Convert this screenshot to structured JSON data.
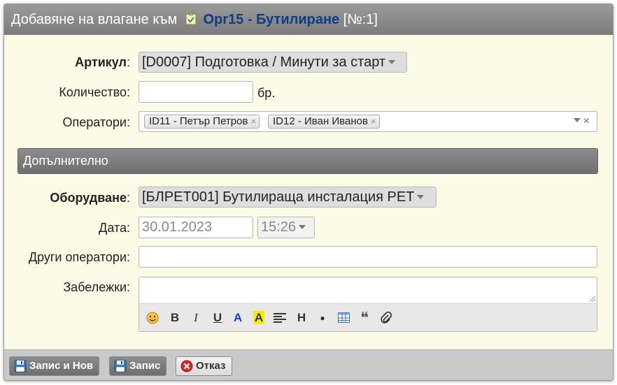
{
  "dialog": {
    "title_prefix": "Добавяне на влагане към",
    "title_link": "Opr15 - Бутилиране",
    "title_suffix": "[№:1]"
  },
  "form": {
    "article_label": "Артикул",
    "article_value": "[D0007] Подготовка / Минути за старт",
    "quantity_label": "Количество:",
    "quantity_value": "",
    "quantity_unit": "бр.",
    "operators_label": "Оператори:",
    "operators": [
      {
        "label": "ID11 - Петър Петров"
      },
      {
        "label": "ID12 - Иван Иванов"
      }
    ],
    "tag_remove": "×",
    "clear_all": "×"
  },
  "extra": {
    "section_title": "Допълнително",
    "equipment_label": "Оборудване",
    "equipment_value": "[БЛРЕТ001] Бутилираща инсталация PET",
    "date_label": "Дата:",
    "date_value": "30.01.2023",
    "time_value": "15:26",
    "other_operators_label": "Други оператори:",
    "other_operators_value": "",
    "notes_label": "Забележки:",
    "notes_value": ""
  },
  "toolbar": {
    "bold": "B",
    "italic": "I",
    "underline": "U",
    "color": "A",
    "bgcolor": "A",
    "heading": "H",
    "bullet": "●",
    "quote": "❝"
  },
  "footer": {
    "save_new_label": "Запис и Нов",
    "save_label": "Запис",
    "cancel_label": "Отказ"
  },
  "colors": {
    "link": "#0c3d87",
    "form_bg": "#fbfbe6",
    "text_color_button": "#1a3ed0",
    "highlight_button": "#f5f000"
  }
}
